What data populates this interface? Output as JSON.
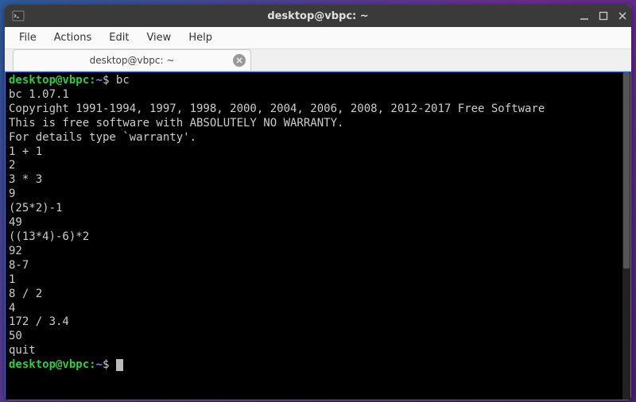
{
  "window": {
    "title": "desktop@vbpc: ~"
  },
  "menubar": {
    "items": [
      "File",
      "Actions",
      "Edit",
      "View",
      "Help"
    ]
  },
  "tab": {
    "label": "desktop@vbpc: ~"
  },
  "prompt": {
    "user_host": "desktop@vbpc",
    "sep": ":",
    "path": "~",
    "symbol": "$"
  },
  "terminal": {
    "cmd1": "bc",
    "lines": [
      "bc 1.07.1",
      "Copyright 1991-1994, 1997, 1998, 2000, 2004, 2006, 2008, 2012-2017 Free Software",
      "This is free software with ABSOLUTELY NO WARRANTY.",
      "For details type `warranty'.",
      "1 + 1",
      "2",
      "3 * 3",
      "9",
      "(25*2)-1",
      "49",
      "((13*4)-6)*2",
      "92",
      "8-7",
      "1",
      "8 / 2",
      "4",
      "172 / 3.4",
      "50",
      "quit"
    ]
  }
}
